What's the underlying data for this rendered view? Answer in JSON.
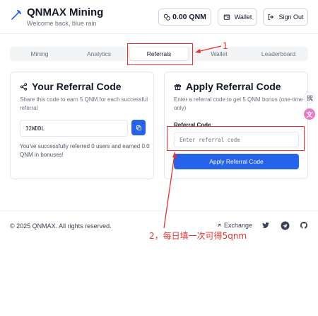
{
  "header": {
    "brand": "QNMAX Mining",
    "welcome": "Welcome back, blue rain",
    "balance": "0.00 QNM",
    "wallet_label": "Wallet",
    "signout_label": "Sign Out"
  },
  "tabs": [
    {
      "label": "Mining",
      "active": false
    },
    {
      "label": "Analytics",
      "active": false
    },
    {
      "label": "Referrals",
      "active": true
    },
    {
      "label": "Wallet",
      "active": false
    },
    {
      "label": "Leaderboard",
      "active": false
    }
  ],
  "referral_card": {
    "title": "Your Referral Code",
    "description": "Share this code to earn 5 QNM for each successful referral",
    "code": "32WDDL",
    "note": "You've successfully referred 0 users and earned 0.0 QNM in bonuses!"
  },
  "apply_card": {
    "title": "Apply Referral Code",
    "description": "Enter a referral code to get 5 QNM bonus (one-time only)",
    "field_label": "Referral Code",
    "placeholder": "Enter referral code",
    "value": "",
    "button_label": "Apply Referral Code"
  },
  "footer": {
    "copyright": "© 2025 QNMAX. All rights reserved.",
    "exchange_label": "Exchange"
  },
  "annotations": {
    "label_1": "1",
    "label_2": "2，每日填一次可得5qnm"
  },
  "colors": {
    "accent": "#2563eb",
    "annotation": "#e8322f"
  },
  "icons": [
    "logo-pickaxe-icon",
    "coin-icon",
    "wallet-icon",
    "logout-icon",
    "share-icon",
    "gift-icon",
    "copy-icon",
    "qr-icon",
    "translate-icon",
    "arrow-up-right-icon",
    "twitter-icon",
    "telegram-icon",
    "github-icon"
  ]
}
